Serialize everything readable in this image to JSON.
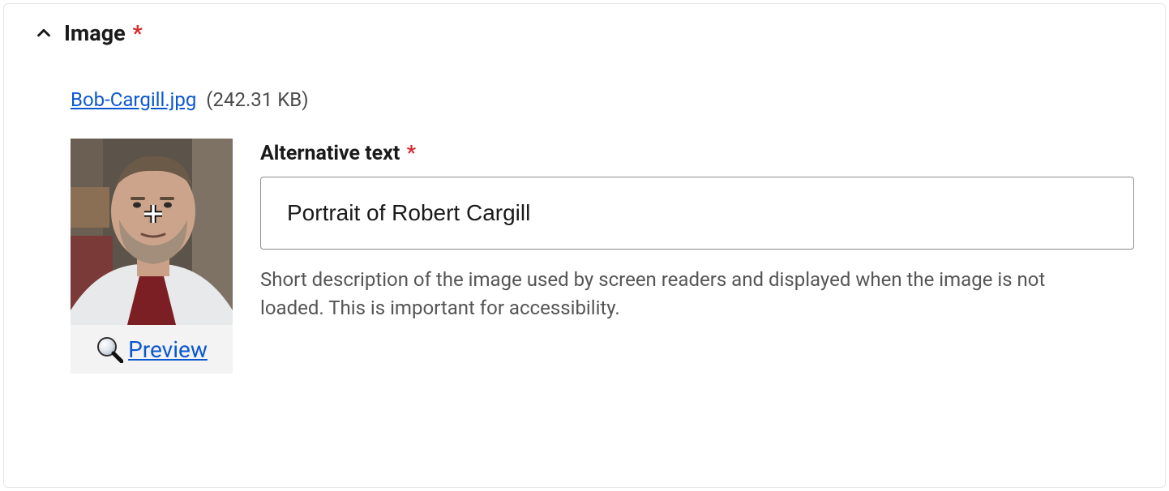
{
  "section": {
    "title": "Image",
    "required_marker": "*"
  },
  "file": {
    "name": "Bob-Cargill.jpg",
    "size_display": "(242.31 KB)"
  },
  "preview": {
    "label": "Preview"
  },
  "alt_text": {
    "label": "Alternative text",
    "required_marker": "*",
    "value": "Portrait of Robert Cargill",
    "help": "Short description of the image used by screen readers and displayed when the image is not loaded. This is important for accessibility."
  }
}
